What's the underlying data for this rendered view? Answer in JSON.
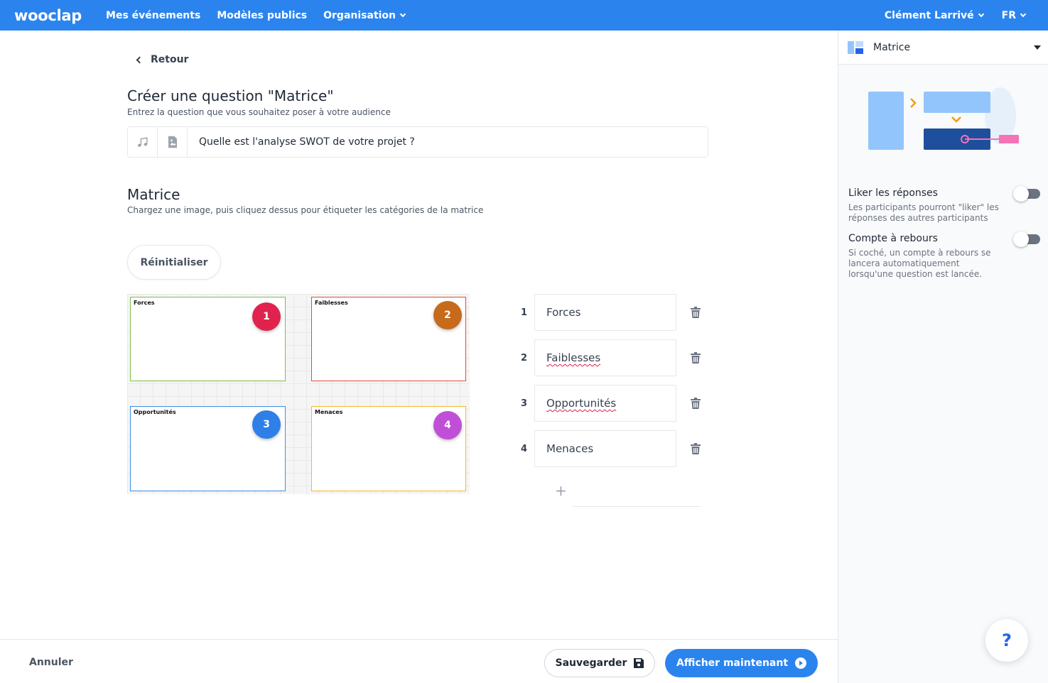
{
  "topbar": {
    "logo": "wooclap",
    "nav": [
      "Mes événements",
      "Modèles publics",
      "Organisation"
    ],
    "user": "Clément Larrivé",
    "lang": "FR"
  },
  "main": {
    "back": "Retour",
    "title": "Créer une question \"Matrice\"",
    "subtitle": "Entrez la question que vous souhaitez poser à votre audience",
    "question": "Quelle est l'analyse SWOT de votre projet ?",
    "matrix_title": "Matrice",
    "matrix_subtitle": "Chargez une image, puis cliquez dessus pour étiqueter les catégories de la matrice",
    "reset": "Réinitialiser",
    "quadrants": [
      {
        "label": "Forces",
        "badge": "1",
        "border": "#7cc04b",
        "badge_color": "#e0234e"
      },
      {
        "label": "Faiblesses",
        "badge": "2",
        "border": "#e44b3a",
        "badge_color": "#c76a1c"
      },
      {
        "label": "Opportunités",
        "badge": "3",
        "border": "#3b8fe8",
        "badge_color": "#2f7fe8"
      },
      {
        "label": "Menaces",
        "badge": "4",
        "border": "#f5b82e",
        "badge_color": "#c04fd8"
      }
    ],
    "categories": [
      {
        "num": "1",
        "value": "Forces"
      },
      {
        "num": "2",
        "value": "Faiblesses"
      },
      {
        "num": "3",
        "value": "Opportunités"
      },
      {
        "num": "4",
        "value": "Menaces"
      }
    ],
    "add_symbol": "+"
  },
  "bottom": {
    "cancel": "Annuler",
    "save": "Sauvegarder",
    "show": "Afficher maintenant"
  },
  "sidebar": {
    "type": "Matrice",
    "options": [
      {
        "title": "Liker les réponses",
        "desc": "Les participants pourront \"liker\" les réponses des autres participants"
      },
      {
        "title": "Compte à rebours",
        "desc": "Si coché, un compte à rebours se lancera automatiquement lorsqu'une question est lancée."
      }
    ]
  },
  "help": "?"
}
